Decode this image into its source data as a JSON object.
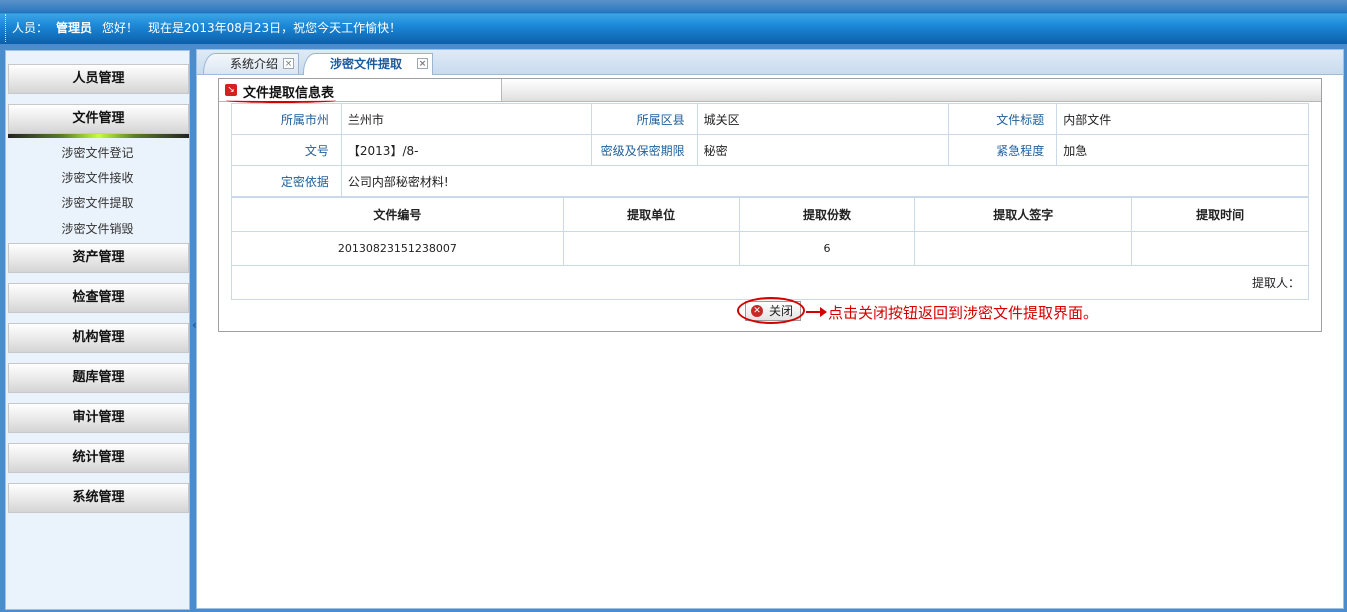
{
  "header": {
    "user_label": "人员：",
    "user_name": "管理员",
    "greeting": "您好！",
    "date_text": "现在是2013年08月23日，祝您今天工作愉快！"
  },
  "sidebar": {
    "sections": [
      {
        "label": "人员管理"
      },
      {
        "label": "文件管理"
      },
      {
        "label": "资产管理"
      },
      {
        "label": "检查管理"
      },
      {
        "label": "机构管理"
      },
      {
        "label": "题库管理"
      },
      {
        "label": "审计管理"
      },
      {
        "label": "统计管理"
      },
      {
        "label": "系统管理"
      }
    ],
    "file_items": [
      {
        "label": "涉密文件登记"
      },
      {
        "label": "涉密文件接收"
      },
      {
        "label": "涉密文件提取"
      },
      {
        "label": "涉密文件销毁"
      }
    ],
    "collapse_glyph": "«"
  },
  "tabs": [
    {
      "label": "系统介绍",
      "close": "×"
    },
    {
      "label": "涉密文件提取",
      "close": "×"
    }
  ],
  "panel": {
    "title": "文件提取信息表",
    "fields": {
      "city_label": "所属市州",
      "city_value": "兰州市",
      "district_label": "所属区县",
      "district_value": "城关区",
      "title_label": "文件标题",
      "title_value": "内部文件",
      "docno_label": "文号",
      "docno_value": "【2013】/8-",
      "level_label": "密级及保密期限",
      "level_value": "秘密",
      "urgency_label": "紧急程度",
      "urgency_value": "加急",
      "basis_label": "定密依据",
      "basis_value": "公司内部秘密材料!"
    },
    "table": {
      "headers": [
        "文件编号",
        "提取单位",
        "提取份数",
        "提取人签字",
        "提取时间"
      ],
      "rows": [
        [
          "20130823151238007",
          "",
          "6",
          "",
          ""
        ]
      ],
      "footer": "提取人："
    },
    "close_button": "关闭",
    "annotation": "点击关闭按钮返回到涉密文件提取界面。"
  },
  "colors": {
    "accent": "#1a5aa0",
    "annotation": "#d40000"
  }
}
